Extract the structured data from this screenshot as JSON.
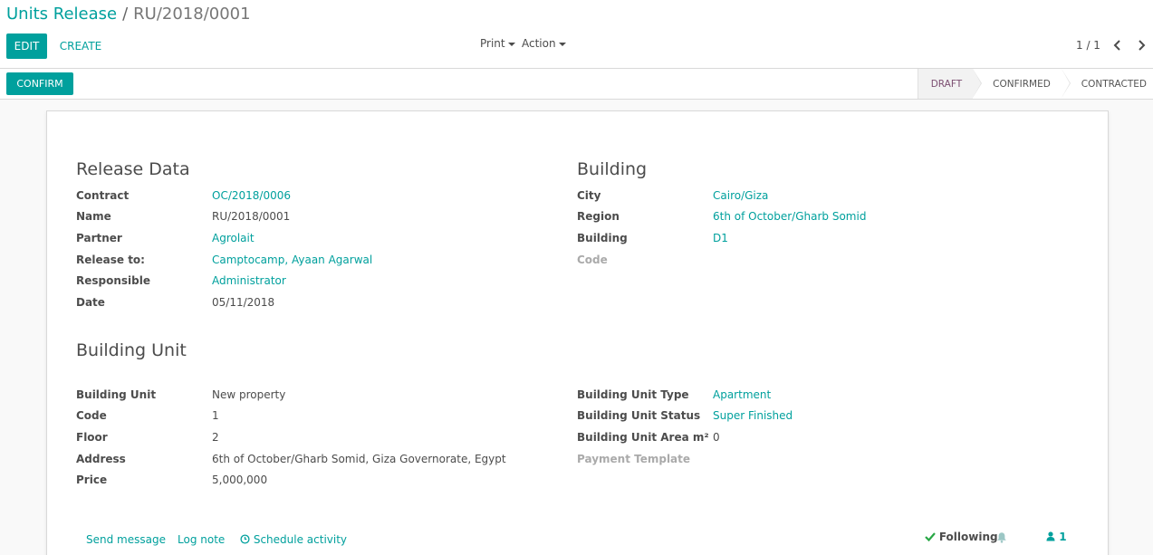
{
  "breadcrumb": {
    "parent": "Units Release",
    "separator": "/",
    "current": "RU/2018/0001"
  },
  "toolbar": {
    "edit_label": "EDIT",
    "create_label": "CREATE",
    "print_label": "Print",
    "action_label": "Action"
  },
  "pager": {
    "value": "1 / 1"
  },
  "statusbar": {
    "confirm_label": "CONFIRM",
    "stages": [
      {
        "label": "DRAFT",
        "active": true
      },
      {
        "label": "CONFIRMED",
        "active": false
      },
      {
        "label": "CONTRACTED",
        "active": false
      }
    ]
  },
  "release_data": {
    "title": "Release Data",
    "fields": [
      {
        "label": "Contract",
        "value": "OC/2018/0006",
        "link": true
      },
      {
        "label": "Name",
        "value": "RU/2018/0001",
        "link": false
      },
      {
        "label": "Partner",
        "value": "Agrolait",
        "link": true
      },
      {
        "label": "Release to:",
        "value": "Camptocamp, Ayaan Agarwal",
        "link": true
      },
      {
        "label": "Responsible",
        "value": "Administrator",
        "link": true
      },
      {
        "label": "Date",
        "value": "05/11/2018",
        "link": false
      }
    ]
  },
  "building": {
    "title": "Building",
    "fields": [
      {
        "label": "City",
        "value": "Cairo/Giza",
        "link": true
      },
      {
        "label": "Region",
        "value": "6th of October/Gharb Somid",
        "link": true
      },
      {
        "label": "Building",
        "value": "D1",
        "link": true
      },
      {
        "label": "Code",
        "value": "",
        "muted": true
      }
    ]
  },
  "building_unit": {
    "title": "Building Unit",
    "left_fields": [
      {
        "label": "Building Unit",
        "value": "New property"
      },
      {
        "label": "Code",
        "value": "1"
      },
      {
        "label": "Floor",
        "value": "2"
      },
      {
        "label": "Address",
        "value": "6th of October/Gharb Somid, Giza Governorate, Egypt"
      },
      {
        "label": "Price",
        "value": "5,000,000"
      }
    ],
    "right_fields": [
      {
        "label": "Building Unit Type",
        "value": "Apartment",
        "link": true
      },
      {
        "label": "Building Unit Status",
        "value": "Super Finished",
        "link": true
      },
      {
        "label": "Building Unit Area m²",
        "value": "0",
        "link": false
      },
      {
        "label": "Payment Template",
        "value": "",
        "muted": true
      }
    ]
  },
  "chatter": {
    "send_message": "Send message",
    "log_note": "Log note",
    "schedule_activity": "Schedule activity",
    "following": "Following",
    "followers_count": "1"
  },
  "colors": {
    "accent": "#00a09d",
    "active_stage": "#7c4e71"
  }
}
